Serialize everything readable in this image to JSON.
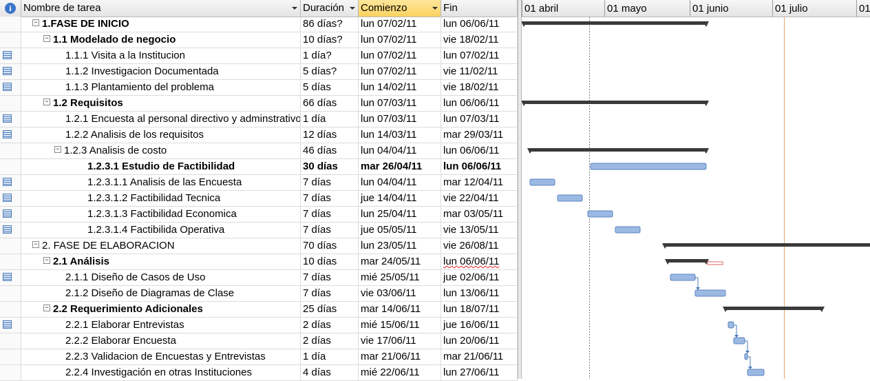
{
  "columns": {
    "info_icon": "i",
    "name": "Nombre de tarea",
    "duration": "Duración",
    "start": "Comienzo",
    "finish": "Fin"
  },
  "timescale": [
    "01 abril",
    "01 mayo",
    "01 junio",
    "01 julio",
    "01"
  ],
  "tasks": [
    {
      "name": "1.FASE DE INICIO",
      "dur": "86 días?",
      "start": "lun 07/02/11",
      "finish": "lun 06/06/11",
      "level": 0,
      "summary": true,
      "bold": true,
      "indicator": false
    },
    {
      "name": "1.1 Modelado de negocio",
      "dur": "10 días?",
      "start": "lun 07/02/11",
      "finish": "vie 18/02/11",
      "level": 1,
      "summary": true,
      "bold": true,
      "indicator": false
    },
    {
      "name": "1.1.1 Visita a la Institucion",
      "dur": "1 día?",
      "start": "lun 07/02/11",
      "finish": "lun 07/02/11",
      "level": 2,
      "summary": false,
      "bold": false,
      "indicator": true
    },
    {
      "name": "1.1.2 Investigacion Documentada",
      "dur": "5 días?",
      "start": "lun 07/02/11",
      "finish": "vie 11/02/11",
      "level": 2,
      "summary": false,
      "bold": false,
      "indicator": true
    },
    {
      "name": "1.1.3 Plantamiento del problema",
      "dur": "5 días",
      "start": "lun 14/02/11",
      "finish": "vie 18/02/11",
      "level": 2,
      "summary": false,
      "bold": false,
      "indicator": true
    },
    {
      "name": "1.2 Requisitos",
      "dur": "66 días",
      "start": "lun 07/03/11",
      "finish": "lun 06/06/11",
      "level": 1,
      "summary": true,
      "bold": true,
      "indicator": false
    },
    {
      "name": "1.2.1 Encuesta al personal directivo y adminstrativo",
      "dur": "1 día",
      "start": "lun 07/03/11",
      "finish": "lun 07/03/11",
      "level": 2,
      "summary": false,
      "bold": false,
      "indicator": true
    },
    {
      "name": "1.2.2 Analisis de los requisitos",
      "dur": "12 días",
      "start": "lun 14/03/11",
      "finish": "mar 29/03/11",
      "level": 2,
      "summary": false,
      "bold": false,
      "indicator": true
    },
    {
      "name": "1.2.3 Analisis de costo",
      "dur": "46 días",
      "start": "lun 04/04/11",
      "finish": "lun 06/06/11",
      "level": 2,
      "summary": true,
      "bold": false,
      "indicator": false
    },
    {
      "name": "1.2.3.1 Estudio de Factibilidad",
      "dur": "30 días",
      "start": "mar 26/04/11",
      "finish": "lun 06/06/11",
      "level": 3,
      "summary": false,
      "bold": true,
      "indicator": false
    },
    {
      "name": "1.2.3.1.1 Analisis de las Encuesta",
      "dur": "7 días",
      "start": "lun 04/04/11",
      "finish": "mar 12/04/11",
      "level": 3,
      "summary": false,
      "bold": false,
      "indicator": true
    },
    {
      "name": "1.2.3.1.2 Factibilidad Tecnica",
      "dur": "7 días",
      "start": "jue 14/04/11",
      "finish": "vie 22/04/11",
      "level": 3,
      "summary": false,
      "bold": false,
      "indicator": true
    },
    {
      "name": "1.2.3.1.3 Factibilidad Economica",
      "dur": "7 días",
      "start": "lun 25/04/11",
      "finish": "mar 03/05/11",
      "level": 3,
      "summary": false,
      "bold": false,
      "indicator": true
    },
    {
      "name": "1.2.3.1.4 Factibilida Operativa",
      "dur": "7 días",
      "start": "jue 05/05/11",
      "finish": "vie 13/05/11",
      "level": 3,
      "summary": false,
      "bold": false,
      "indicator": true
    },
    {
      "name": "2. FASE DE ELABORACION",
      "dur": "70 días",
      "start": "lun 23/05/11",
      "finish": "vie 26/08/11",
      "level": 0,
      "summary": true,
      "bold": false,
      "indicator": false
    },
    {
      "name": "2.1 Análisis",
      "dur": "10 días",
      "start": "mar 24/05/11",
      "finish": "lun 06/06/11",
      "level": 1,
      "summary": true,
      "bold": true,
      "indicator": false,
      "squiggle_finish": true
    },
    {
      "name": "2.1.1 Diseño de Casos de Uso",
      "dur": "7 días",
      "start": "mié 25/05/11",
      "finish": "jue 02/06/11",
      "level": 2,
      "summary": false,
      "bold": false,
      "indicator": true
    },
    {
      "name": "2.1.2 Diseño de Diagramas de Clase",
      "dur": "7 días",
      "start": "vie 03/06/11",
      "finish": "lun 13/06/11",
      "level": 2,
      "summary": false,
      "bold": false,
      "indicator": false
    },
    {
      "name": "2.2 Requerimiento Adicionales",
      "dur": "25 días",
      "start": "mar 14/06/11",
      "finish": "lun 18/07/11",
      "level": 1,
      "summary": true,
      "bold": true,
      "indicator": false
    },
    {
      "name": "2.2.1 Elaborar Entrevistas",
      "dur": "2 días",
      "start": "mié 15/06/11",
      "finish": "jue 16/06/11",
      "level": 2,
      "summary": false,
      "bold": false,
      "indicator": true
    },
    {
      "name": "2.2.2 Elaborar Encuesta",
      "dur": "2 días",
      "start": "vie 17/06/11",
      "finish": "lun 20/06/11",
      "level": 2,
      "summary": false,
      "bold": false,
      "indicator": false
    },
    {
      "name": "2.2.3 Validacion de Encuestas y Entrevistas",
      "dur": "1 día",
      "start": "mar 21/06/11",
      "finish": "mar 21/06/11",
      "level": 2,
      "summary": false,
      "bold": false,
      "indicator": false
    },
    {
      "name": "2.2.4 Investigación en otras Instituciones",
      "dur": "4 días",
      "start": "mié 22/06/11",
      "finish": "lun 27/06/11",
      "level": 2,
      "summary": false,
      "bold": false,
      "indicator": false
    }
  ],
  "colors": {
    "summary_bar": "#3a3a3a",
    "task_bar": "#9bb9e3",
    "task_bar_border": "#5b82be",
    "status_date_line": "#e8a36a",
    "link_line": "#4a7ab7",
    "slack_bar": "#e06060"
  }
}
